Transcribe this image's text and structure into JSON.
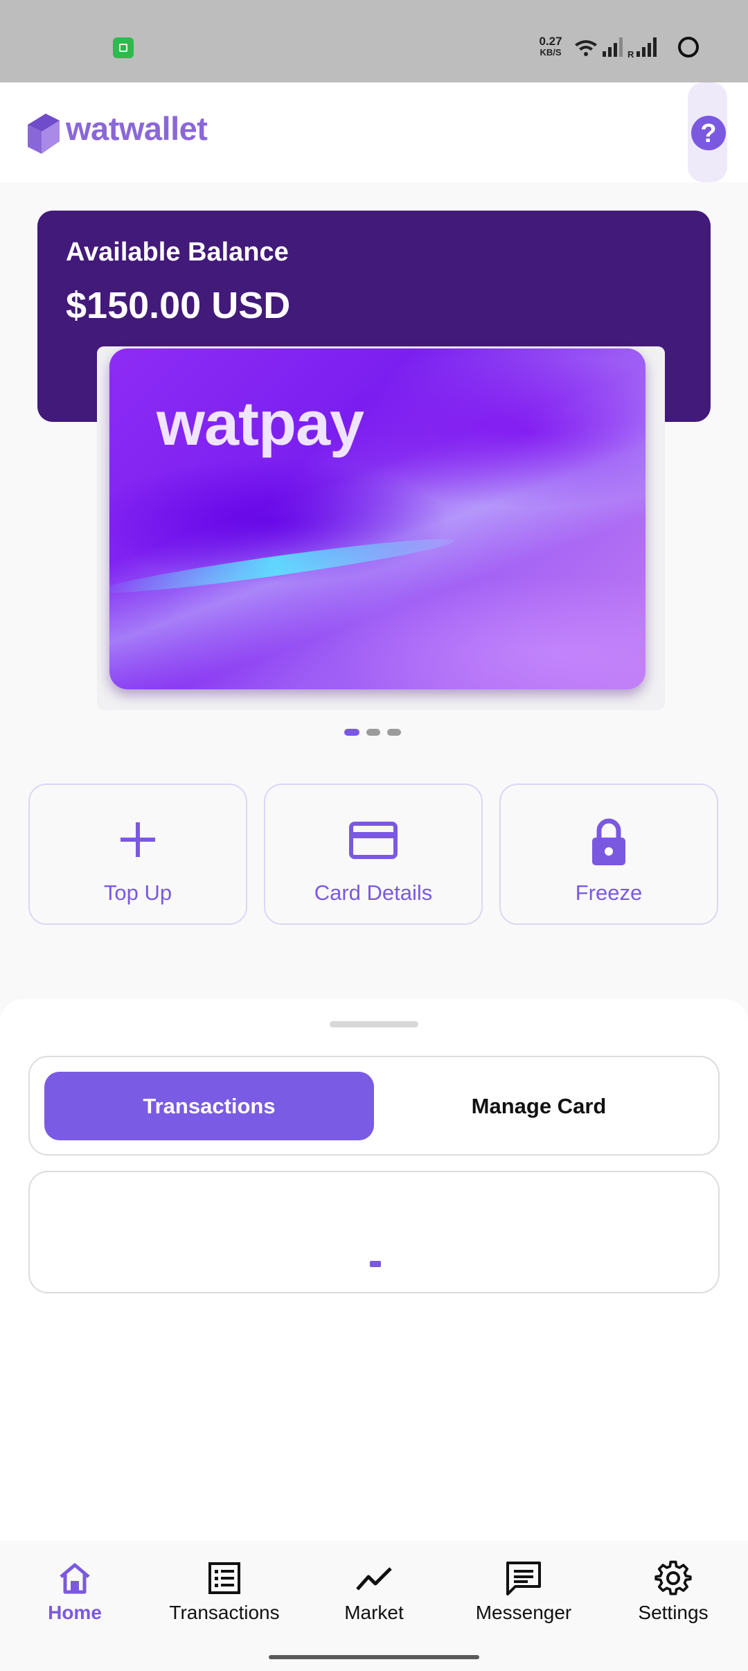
{
  "status_bar": {
    "network_speed": "0.27",
    "network_unit": "KB/S",
    "icons": [
      "app-notification-icon",
      "wifi-icon",
      "signal-icon",
      "roaming-signal-icon",
      "battery-ring-icon"
    ]
  },
  "header": {
    "brand": "watwallet",
    "help_label": "?"
  },
  "balance": {
    "label": "Available Balance",
    "value": "$150.00 USD"
  },
  "card": {
    "brand": "watpay",
    "carousel_index": 1,
    "carousel_count": 3
  },
  "actions": [
    {
      "label": "Top Up",
      "icon": "plus-icon"
    },
    {
      "label": "Card Details",
      "icon": "credit-card-icon"
    },
    {
      "label": "Freeze",
      "icon": "lock-icon"
    }
  ],
  "sheet": {
    "tabs": [
      "Transactions",
      "Manage Card"
    ],
    "active_tab": "Transactions"
  },
  "bottom_nav": {
    "items": [
      {
        "label": "Home",
        "icon": "home-icon",
        "active": true
      },
      {
        "label": "Transactions",
        "icon": "list-icon",
        "active": false
      },
      {
        "label": "Market",
        "icon": "trend-icon",
        "active": false
      },
      {
        "label": "Messenger",
        "icon": "message-icon",
        "active": false
      },
      {
        "label": "Settings",
        "icon": "gear-icon",
        "active": false
      }
    ]
  },
  "colors": {
    "accent": "#7a59e0",
    "balance_bg": "#421a7a",
    "status_bar": "#bdbdbd"
  }
}
